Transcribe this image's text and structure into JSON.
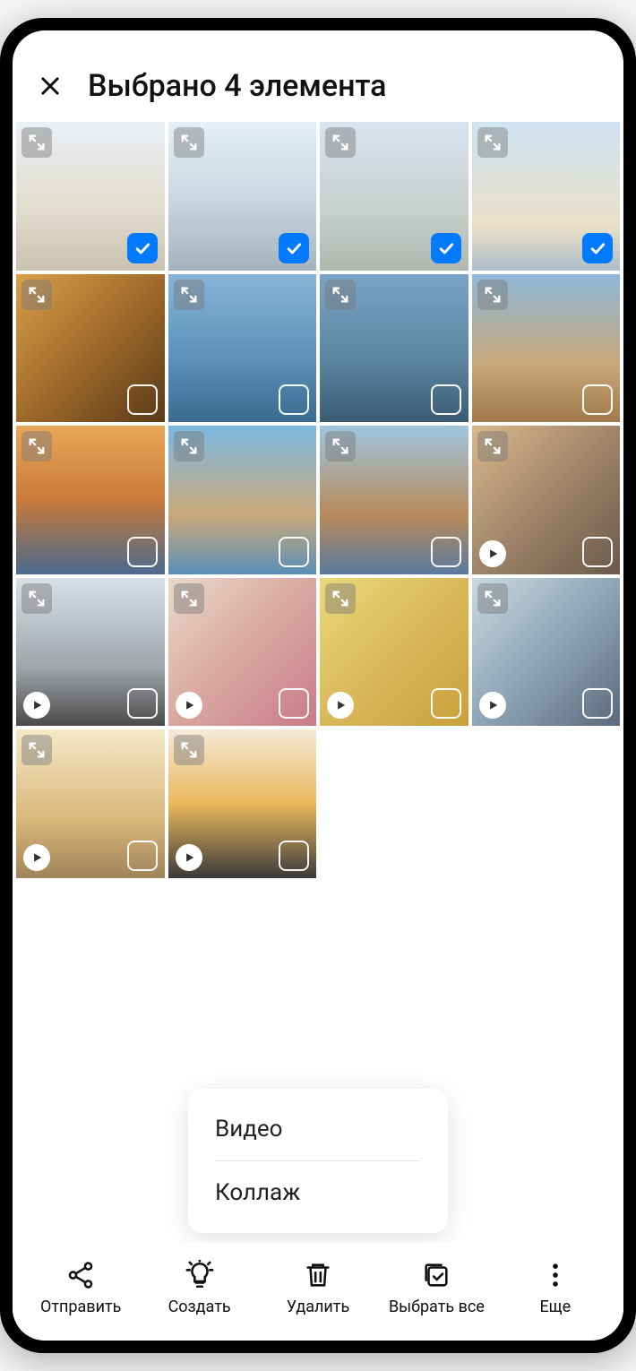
{
  "header": {
    "title": "Выбрано 4 элемента"
  },
  "thumbs": [
    {
      "selected": true,
      "video": false,
      "bg": "linear-gradient(180deg,#d9e4ee 0%,#c9bfa3 60%,#a08f6e 100%)"
    },
    {
      "selected": true,
      "video": false,
      "bg": "linear-gradient(180deg,#cfe3ef 0%,#9fb8c8 50%,#5a7486 100%)"
    },
    {
      "selected": true,
      "video": false,
      "bg": "linear-gradient(180deg,#b8cde0 0%,#9aa8a2 60%,#6f7c6d 100%)"
    },
    {
      "selected": true,
      "video": false,
      "bg": "linear-gradient(180deg,#a9cde8 0%,#d9c89a 70%,#6a889f 100%)"
    },
    {
      "selected": false,
      "video": false,
      "bg": "linear-gradient(135deg,#d9a14a 0%,#a06a2a 50%,#5a3a18 100%)"
    },
    {
      "selected": false,
      "video": false,
      "bg": "linear-gradient(180deg,#87b5d6 0%,#5a8fb8 60%,#3a6a8f 100%)"
    },
    {
      "selected": false,
      "video": false,
      "bg": "linear-gradient(180deg,#7aa3c6 0%,#5a849f 60%,#3a5a72 100%)"
    },
    {
      "selected": false,
      "video": false,
      "bg": "linear-gradient(180deg,#8fb8d9 0%,#c9a87a 60%,#a07a4a 100%)"
    },
    {
      "selected": false,
      "video": false,
      "bg": "linear-gradient(180deg,#e9a85a 0%,#c97a3a 50%,#4a6a8f 100%)"
    },
    {
      "selected": false,
      "video": false,
      "bg": "linear-gradient(180deg,#7ab8e0 0%,#c9a87a 60%,#5a8fb8 100%)"
    },
    {
      "selected": false,
      "video": false,
      "bg": "linear-gradient(180deg,#9fc6e0 0%,#b88a5a 60%,#5a7a9f 100%)"
    },
    {
      "selected": false,
      "video": true,
      "bg": "linear-gradient(135deg,#d9b88a 0%,#a0846a 50%,#6a5a4a 100%)"
    },
    {
      "selected": false,
      "video": true,
      "bg": "linear-gradient(180deg,#d9e0e6 0%,#a0a6aa 60%,#4a4a4a 100%)"
    },
    {
      "selected": false,
      "video": true,
      "bg": "linear-gradient(135deg,#e9d9c9 0%,#d9a89f 50%,#c97a8a 100%)"
    },
    {
      "selected": false,
      "video": true,
      "bg": "linear-gradient(135deg,#e9d97a 0%,#d9b85a 50%,#c9a03a 100%)"
    },
    {
      "selected": false,
      "video": true,
      "bg": "linear-gradient(135deg,#c9d9e0 0%,#8fa6b8 50%,#5a6a7a 100%)"
    },
    {
      "selected": false,
      "video": true,
      "bg": "linear-gradient(180deg,#f5e9c9 0%,#d9b87a 60%,#a0845a 100%)"
    },
    {
      "selected": false,
      "video": true,
      "bg": "linear-gradient(180deg,#f5e9d9 0%,#e9b85a 50%,#3a3a3a 100%)"
    }
  ],
  "popup": {
    "items": [
      "Видео",
      "Коллаж"
    ]
  },
  "bottomBar": {
    "send": "Отправить",
    "create": "Создать",
    "delete": "Удалить",
    "selectAll": "Выбрать все",
    "more": "Еще"
  }
}
